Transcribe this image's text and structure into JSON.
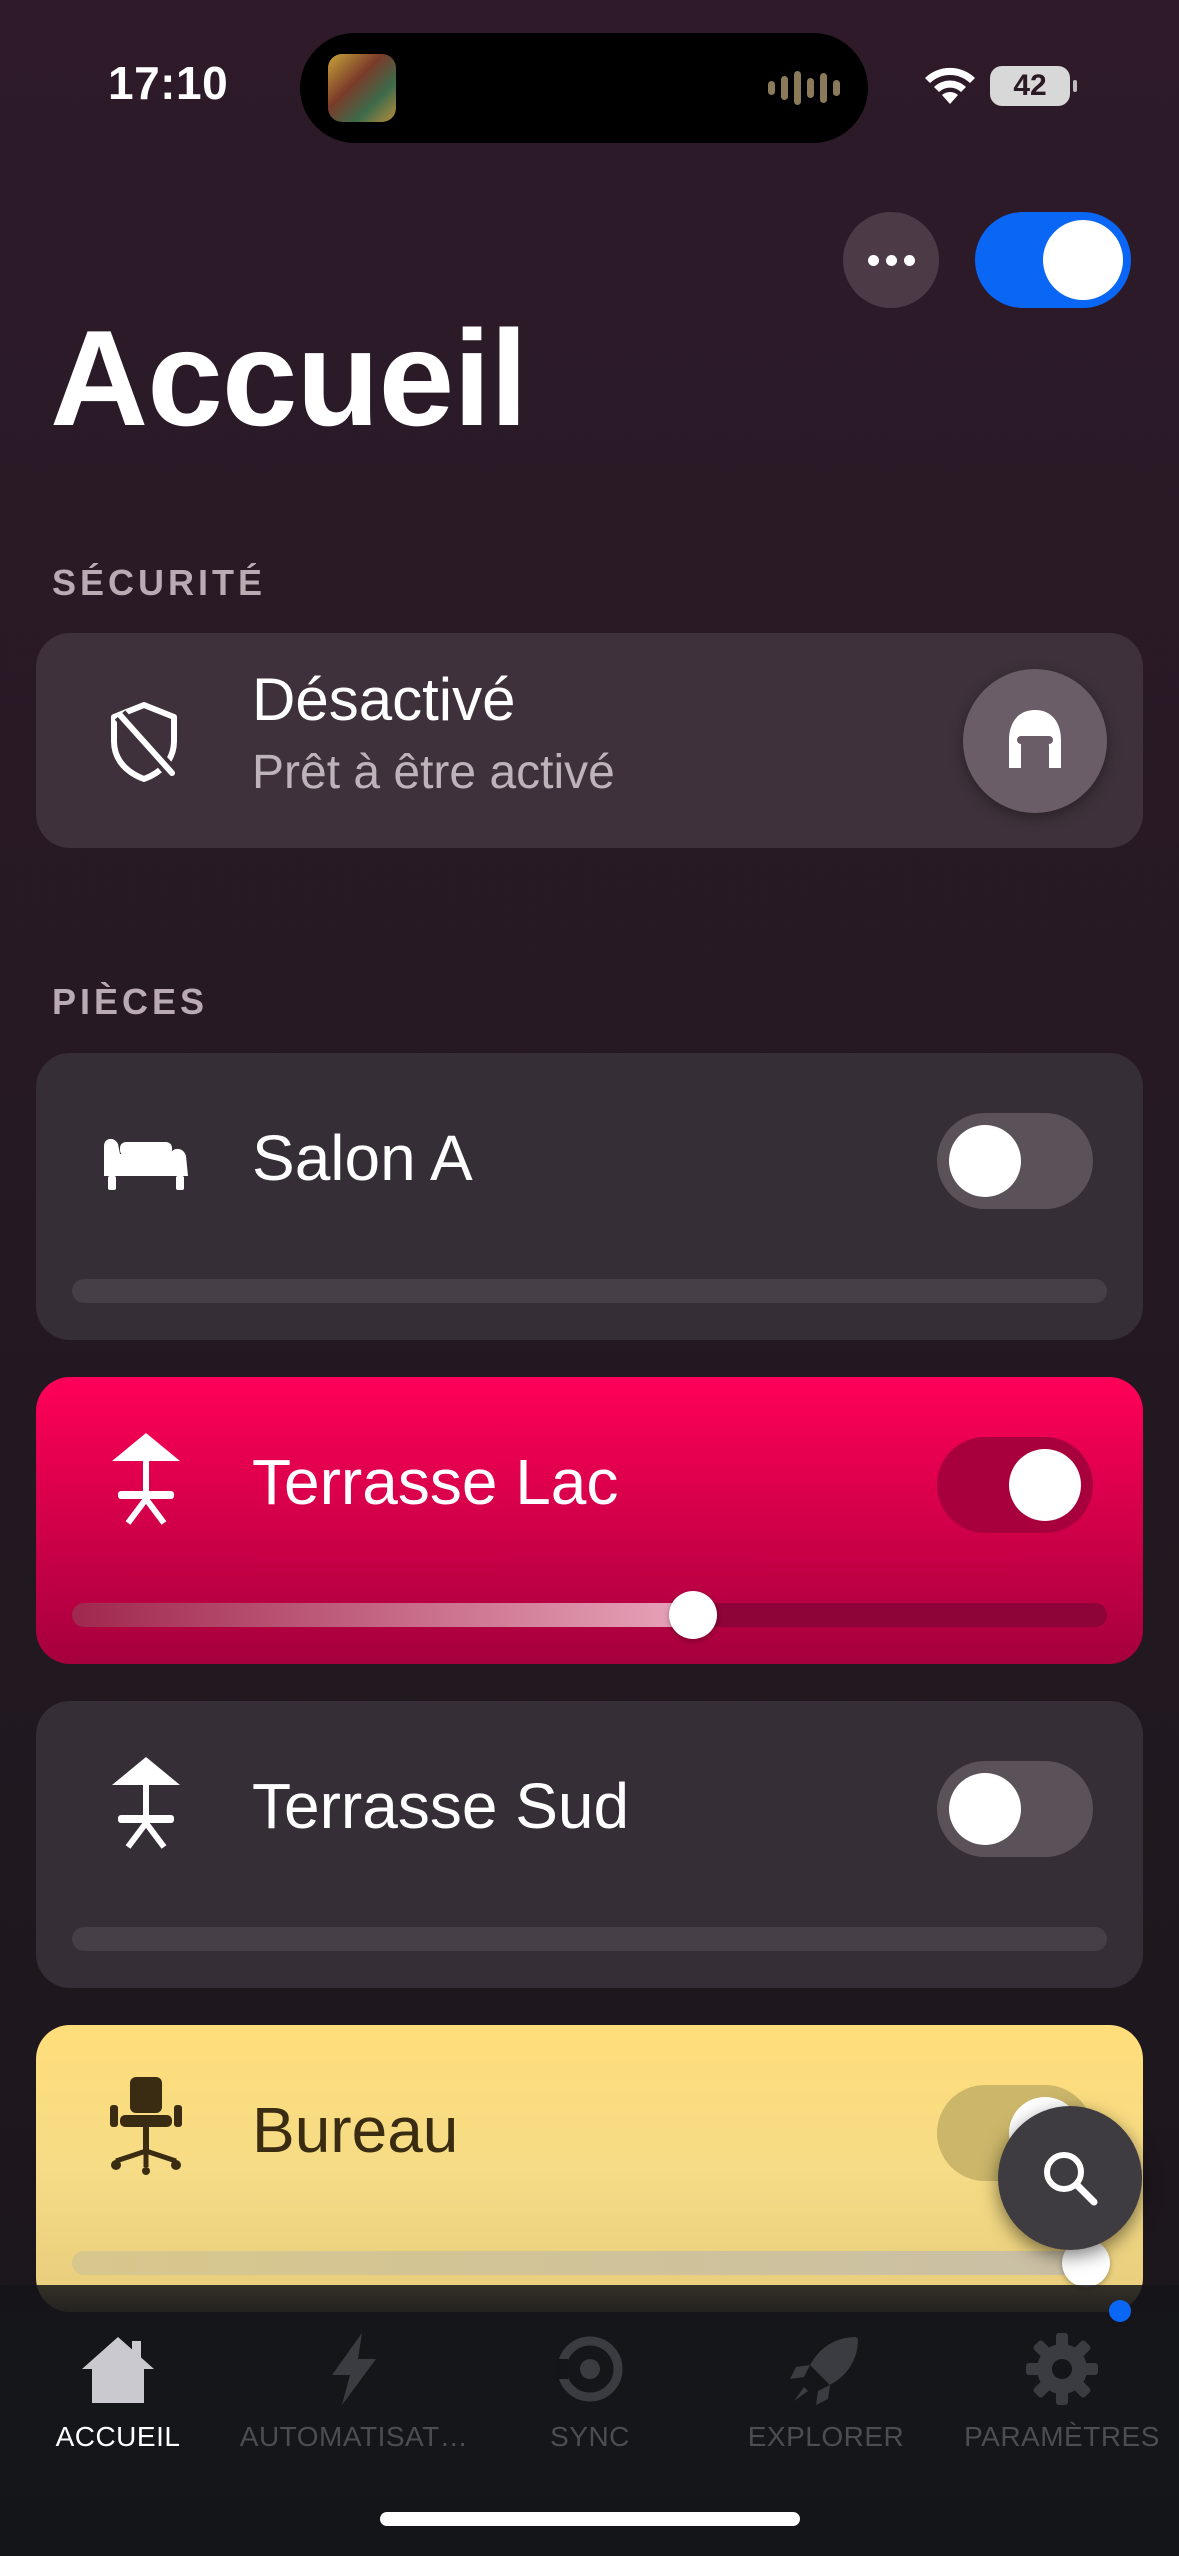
{
  "status": {
    "time": "17:10",
    "battery": "42"
  },
  "header": {
    "title": "Accueil",
    "more_icon": "ellipsis-icon",
    "master_toggle_on": true
  },
  "security": {
    "section_label": "SÉCURITÉ",
    "title": "Désactivé",
    "subtitle": "Prêt à être activé",
    "icon": "shield-off-icon",
    "button_icon": "helmet-icon"
  },
  "rooms": {
    "section_label": "PIÈCES",
    "items": [
      {
        "name": "Salon A",
        "icon": "sofa-icon",
        "on": false,
        "level": 0
      },
      {
        "name": "Terrasse Lac",
        "icon": "parasol-table-icon",
        "on": true,
        "level": 0.6,
        "color": "#ff0058"
      },
      {
        "name": "Terrasse Sud",
        "icon": "parasol-table-icon",
        "on": false,
        "level": 0
      },
      {
        "name": "Bureau",
        "icon": "office-chair-icon",
        "on": true,
        "level": 1.0,
        "color": "#ffdd7a"
      }
    ]
  },
  "tabs": [
    {
      "label": "ACCUEIL",
      "icon": "home-icon",
      "active": true
    },
    {
      "label": "AUTOMATISAT…",
      "icon": "lightning-icon",
      "active": false
    },
    {
      "label": "SYNC",
      "icon": "sync-icon",
      "active": false
    },
    {
      "label": "EXPLORER",
      "icon": "rocket-icon",
      "active": false
    },
    {
      "label": "PARAMÈTRES",
      "icon": "gear-icon",
      "active": false
    }
  ],
  "colors": {
    "accent": "#0a66f5",
    "background": "#2e1a29"
  }
}
